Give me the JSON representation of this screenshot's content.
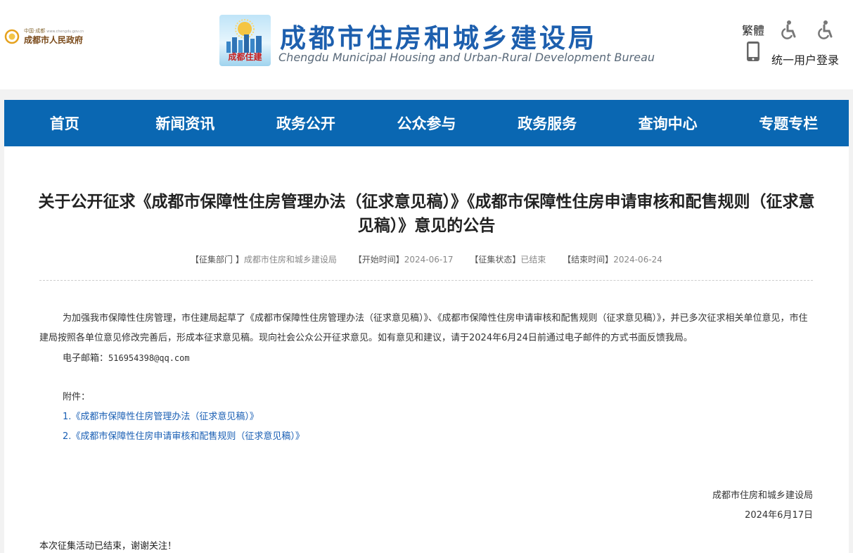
{
  "header": {
    "gov_portal": {
      "line1": "中国·成都",
      "url": "www.chengdu.gov.cn",
      "line2": "成都市人民政府"
    },
    "logo_label": "成都住建",
    "title": "成都市住房和城乡建设局",
    "subtitle": "Chengdu Municipal Housing and Urban-Rural Development Bureau",
    "traditional_label": "繁體",
    "login_label": "统一用户登录"
  },
  "nav": {
    "items": [
      "首页",
      "新闻资讯",
      "政务公开",
      "公众参与",
      "政务服务",
      "查询中心",
      "专题专栏"
    ]
  },
  "article": {
    "title": "关于公开征求《成都市保障性住房管理办法（征求意见稿）》《成都市保障性住房申请审核和配售规则（征求意见稿）》意见的公告",
    "meta": {
      "dept_label": "【征集部门 】",
      "dept_value": "成都市住房和城乡建设局",
      "start_label": "【开始时间】",
      "start_value": "2024-06-17",
      "status_label": "【征集状态】",
      "status_value": "已结束",
      "end_label": "【结束时间】",
      "end_value": "2024-06-24"
    },
    "paragraph": "为加强我市保障性住房管理，市住建局起草了《成都市保障性住房管理办法（征求意见稿）》、《成都市保障性住房申请审核和配售规则（征求意见稿）》，并已多次征求相关单位意见，市住建局按照各单位意见修改完善后，形成本征求意见稿。现向社会公众公开征求意见。如有意见和建议，请于2024年6月24日前通过电子邮件的方式书面反馈我局。",
    "email_label": "电子邮箱：",
    "email_value": "516954398@qq.com",
    "attachments_label": "附件：",
    "attachments": [
      "1.《成都市保障性住房管理办法（征求意见稿）》",
      "2.《成都市保障性住房申请审核和配售规则（征求意见稿）》"
    ],
    "signature_org": "成都市住房和城乡建设局",
    "signature_date": "2024年6月17日",
    "end_note": "本次征集活动已结束，谢谢关注！"
  },
  "colors": {
    "nav_bg": "#0a67b2",
    "title_blue": "#1d5fae",
    "link_blue": "#1a5fb4"
  }
}
